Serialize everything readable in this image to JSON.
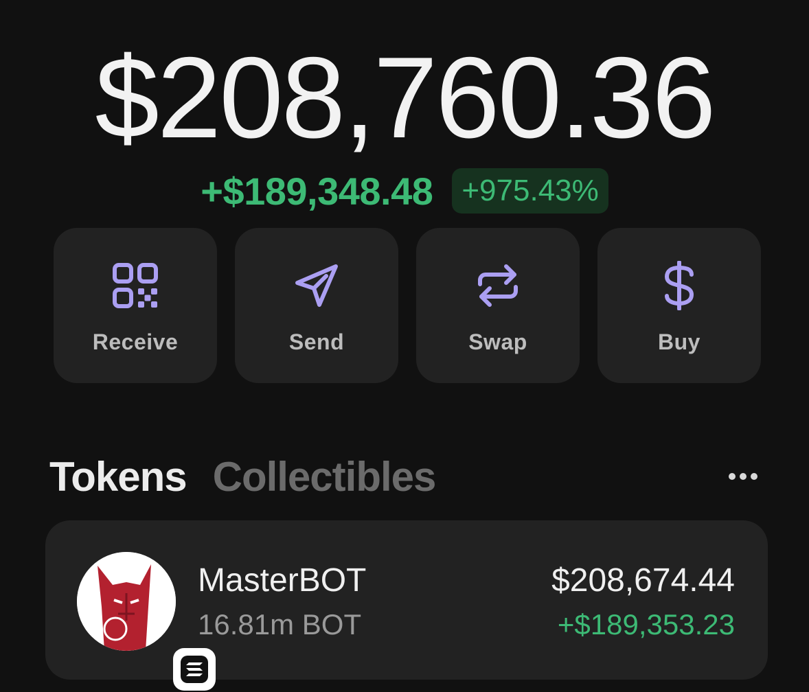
{
  "portfolio": {
    "balance": "$208,760.36",
    "change_amount": "+$189,348.48",
    "change_percent": "+975.43%"
  },
  "actions": [
    {
      "label": "Receive",
      "icon": "qr-code-icon"
    },
    {
      "label": "Send",
      "icon": "send-icon"
    },
    {
      "label": "Swap",
      "icon": "swap-icon"
    },
    {
      "label": "Buy",
      "icon": "dollar-icon"
    }
  ],
  "tabs": [
    {
      "label": "Tokens",
      "active": true
    },
    {
      "label": "Collectibles",
      "active": false
    }
  ],
  "tokens": [
    {
      "name": "MasterBOT",
      "quantity": "16.81m BOT",
      "value": "$208,674.44",
      "pnl": "+$189,353.23",
      "icon": "masterbot-logo-icon",
      "chain_icon": "solana-icon"
    }
  ],
  "colors": {
    "background": "#111111",
    "card": "#222222",
    "accent": "#ab9ff2",
    "positive": "#3dba75",
    "positive_bg": "#16321f"
  }
}
